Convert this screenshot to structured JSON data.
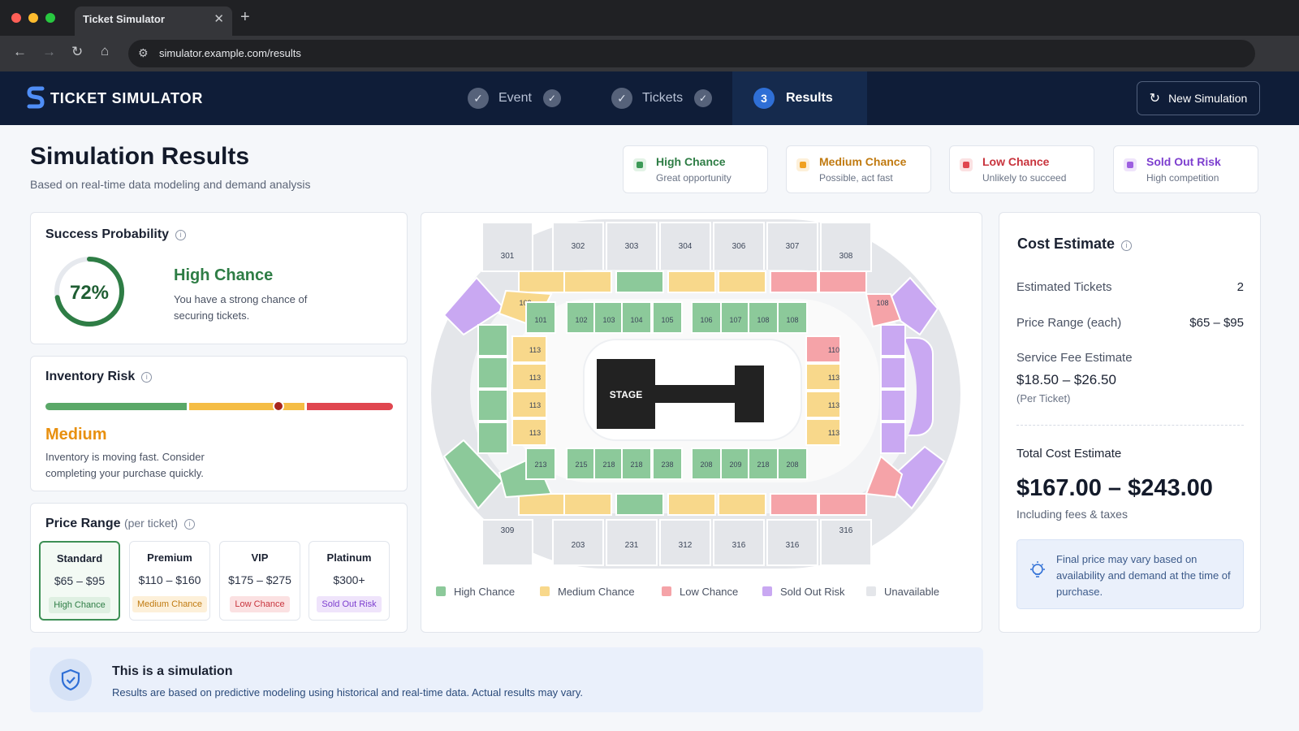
{
  "browser": {
    "tab_title": "Ticket Simulator",
    "url": "simulator.example.com/results"
  },
  "app": {
    "brand": "TICKET SIMULATOR",
    "steps": [
      {
        "label": "Event",
        "state": "done"
      },
      {
        "label": "Tickets",
        "state": "done"
      },
      {
        "label": "Results",
        "state": "active",
        "number": "3"
      }
    ],
    "new_simulation_label": "New Simulation"
  },
  "page": {
    "title": "Simulation Results",
    "subtitle": "Based on real-time data modeling and demand analysis"
  },
  "legend_cards": [
    {
      "title": "High Chance",
      "subtitle": "Great opportunity",
      "color": "#3d9a57",
      "bg": "#e3f3e6"
    },
    {
      "title": "Medium Chance",
      "subtitle": "Possible, act fast",
      "color": "#f0a020",
      "bg": "#fdf0d9"
    },
    {
      "title": "Low Chance",
      "subtitle": "Unlikely to succeed",
      "color": "#e0464f",
      "bg": "#fbe1e2"
    },
    {
      "title": "Sold Out Risk",
      "subtitle": "High competition",
      "color": "#9d5fe0",
      "bg": "#efe4fb"
    }
  ],
  "success": {
    "heading": "Success Probability",
    "percent_label": "72%",
    "percent": 72,
    "status": "High Chance",
    "description": "You have a strong chance of securing tickets."
  },
  "inventory": {
    "heading": "Inventory Risk",
    "level": "Medium",
    "description": "Inventory is moving fast. Consider completing your purchase quickly.",
    "marker_fraction": 0.67
  },
  "price_range": {
    "heading": "Price Range",
    "qualifier": "(per ticket)",
    "tiers": [
      {
        "name": "Standard",
        "price": "$65 – $95",
        "badge": "High Chance",
        "selected": true
      },
      {
        "name": "Premium",
        "price": "$110 – $160",
        "badge": "Medium Chance"
      },
      {
        "name": "VIP",
        "price": "$175 – $275",
        "badge": "Low Chance"
      },
      {
        "name": "Platinum",
        "price": "$300+",
        "badge": "Sold Out Risk"
      }
    ]
  },
  "map": {
    "stage_label": "STAGE",
    "legend": [
      "High Chance",
      "Medium Chance",
      "Low Chance",
      "Sold Out Risk",
      "Unavailable"
    ],
    "upper_top_labels": [
      "301",
      "302",
      "303",
      "304",
      "306",
      "307",
      "308"
    ],
    "upper_bottom_labels": [
      "309",
      "203",
      "231",
      "312",
      "316",
      "316",
      "316"
    ],
    "mid_top_labels": [
      "103",
      "108"
    ],
    "inner_top_labels": [
      "101",
      "102",
      "103",
      "104",
      "105",
      "106",
      "107",
      "108",
      "108"
    ],
    "inner_bottom_labels": [
      "213",
      "215",
      "218",
      "218",
      "238",
      "208",
      "209",
      "218",
      "208"
    ],
    "left_labels": [
      "113",
      "113",
      "113",
      "113"
    ],
    "right_labels": [
      "110",
      "113",
      "113",
      "113"
    ]
  },
  "cost": {
    "heading": "Cost Estimate",
    "estimated_tickets_label": "Estimated Tickets",
    "estimated_tickets": "2",
    "price_range_label": "Price Range (each)",
    "price_range": "$65 – $95",
    "service_fee_label": "Service Fee Estimate",
    "service_fee": "$18.50 – $26.50",
    "service_fee_note": "(Per Ticket)",
    "total_label": "Total Cost Estimate",
    "total": "$167.00 – $243.00",
    "total_note": "Including fees & taxes",
    "tip": "Final price may vary based on availability and demand at the time of purchase."
  },
  "simulation_note": {
    "title": "This is a simulation",
    "text": "Results are based on predictive modeling using historical and real-time data. Actual results may vary."
  },
  "colors": {
    "high": "#8cc99a",
    "medium": "#f8d88b",
    "low": "#f5a3a8",
    "soldout": "#c9a8f2",
    "unavailable": "#e4e6ea",
    "accent": "#2f6fd6",
    "header": "#0f1d38"
  }
}
